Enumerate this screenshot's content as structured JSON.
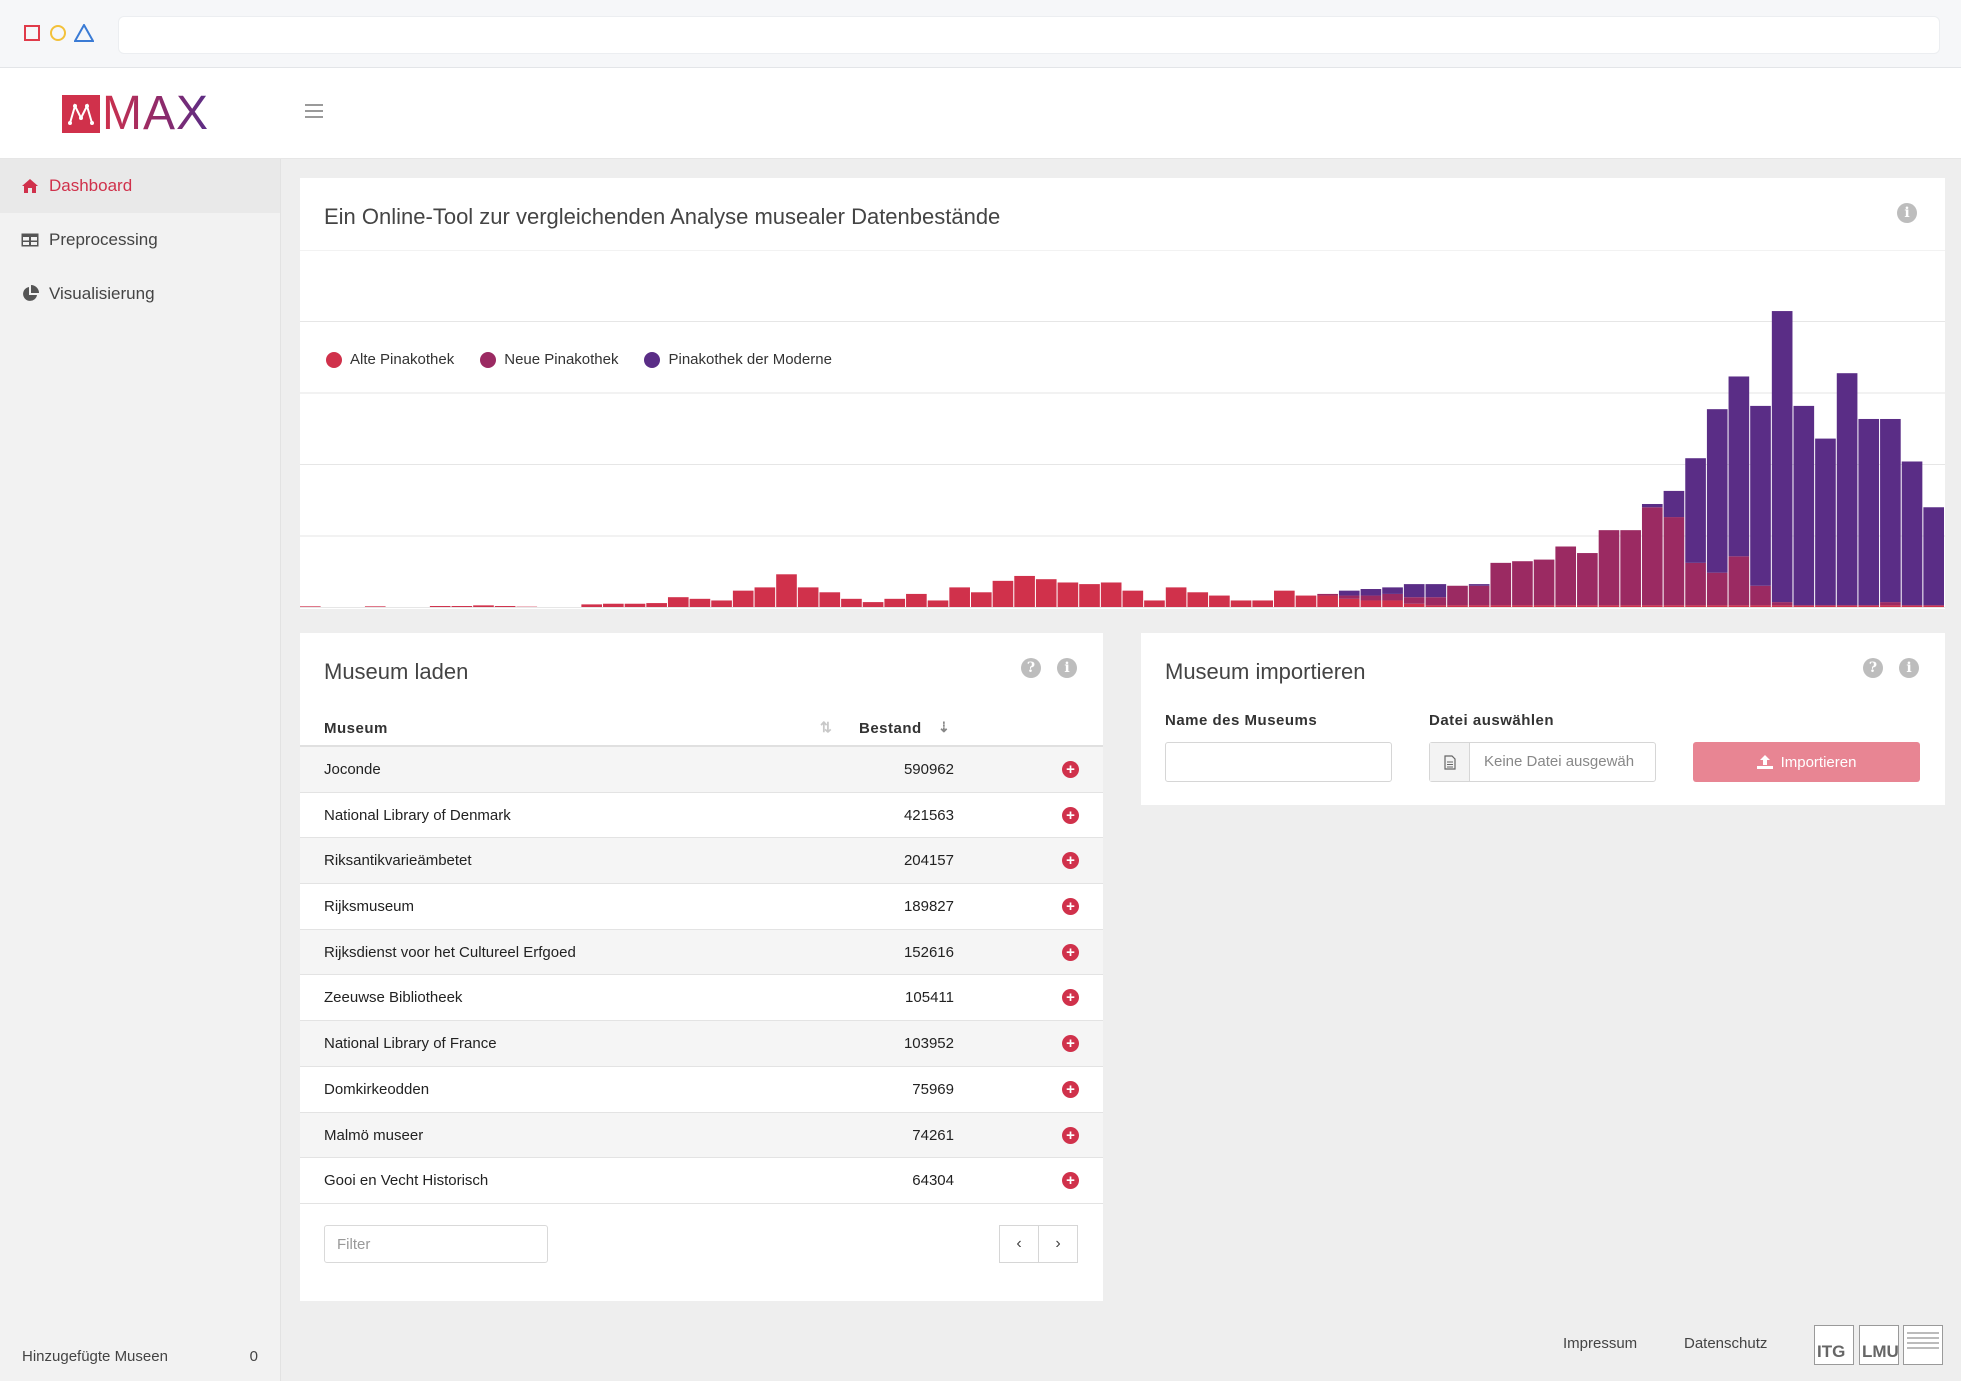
{
  "colors": {
    "accent": "#d0314b",
    "alte": "#d0314b",
    "neue": "#9b2a62",
    "moderne": "#5a2d86"
  },
  "header": {
    "logo_text": "MAX",
    "menu_icon": "hamburger-icon"
  },
  "sidebar": {
    "items": [
      {
        "label": "Dashboard",
        "icon": "home-icon",
        "active": true
      },
      {
        "label": "Preprocessing",
        "icon": "table-icon",
        "active": false
      },
      {
        "label": "Visualisierung",
        "icon": "pie-chart-icon",
        "active": false
      }
    ],
    "footer": {
      "label": "Hinzugefügte Museen",
      "count": "0"
    }
  },
  "chart_card": {
    "title": "Ein Online-Tool zur vergleichenden Analyse musealer Datenbestände"
  },
  "chart_data": {
    "type": "bar",
    "stacked": true,
    "legend_position": "top-left",
    "grid": true,
    "series": [
      {
        "name": "Alte Pinakothek",
        "color": "#d0314b"
      },
      {
        "name": "Neue Pinakothek",
        "color": "#9b2a62"
      },
      {
        "name": "Pinakothek der Moderne",
        "color": "#5a2d86"
      }
    ],
    "values": [
      [
        0.2,
        0,
        0
      ],
      [
        0,
        0,
        0
      ],
      [
        0,
        0,
        0
      ],
      [
        0.2,
        0,
        0
      ],
      [
        0,
        0,
        0
      ],
      [
        0,
        0,
        0
      ],
      [
        0.3,
        0,
        0
      ],
      [
        0.3,
        0,
        0
      ],
      [
        0.5,
        0,
        0
      ],
      [
        0.3,
        0,
        0
      ],
      [
        0.1,
        0,
        0
      ],
      [
        0,
        0,
        0
      ],
      [
        0,
        0,
        0
      ],
      [
        0.8,
        0,
        0
      ],
      [
        1,
        0,
        0
      ],
      [
        1,
        0,
        0
      ],
      [
        1.2,
        0,
        0
      ],
      [
        3,
        0,
        0
      ],
      [
        2.5,
        0,
        0
      ],
      [
        2,
        0,
        0
      ],
      [
        5,
        0,
        0
      ],
      [
        6,
        0,
        0
      ],
      [
        10,
        0,
        0
      ],
      [
        6,
        0,
        0
      ],
      [
        4.5,
        0,
        0
      ],
      [
        2.5,
        0,
        0
      ],
      [
        1.5,
        0,
        0
      ],
      [
        2.5,
        0,
        0
      ],
      [
        4,
        0,
        0
      ],
      [
        2,
        0,
        0
      ],
      [
        6,
        0,
        0
      ],
      [
        4.5,
        0,
        0
      ],
      [
        8,
        0,
        0
      ],
      [
        9.5,
        0,
        0
      ],
      [
        8.5,
        0,
        0
      ],
      [
        7.5,
        0,
        0
      ],
      [
        7,
        0,
        0
      ],
      [
        7.5,
        0,
        0
      ],
      [
        5,
        0,
        0
      ],
      [
        2,
        0,
        0
      ],
      [
        6,
        0,
        0
      ],
      [
        4.5,
        0,
        0
      ],
      [
        3.5,
        0,
        0
      ],
      [
        2,
        0,
        0
      ],
      [
        2,
        0,
        0
      ],
      [
        5,
        0,
        0
      ],
      [
        3.5,
        0,
        0
      ],
      [
        3.5,
        0.5,
        0
      ],
      [
        2.5,
        1,
        1.5
      ],
      [
        2,
        1.5,
        2
      ],
      [
        2,
        2,
        2
      ],
      [
        1,
        2,
        4
      ],
      [
        0.5,
        2.5,
        4
      ],
      [
        0.5,
        6,
        0
      ],
      [
        0.5,
        6,
        0.5
      ],
      [
        0.5,
        13,
        0
      ],
      [
        0.5,
        13.5,
        0
      ],
      [
        0.5,
        14,
        0
      ],
      [
        0.5,
        18,
        0
      ],
      [
        0.5,
        16,
        0
      ],
      [
        0.5,
        23,
        0
      ],
      [
        0.5,
        23,
        0
      ],
      [
        0.5,
        30,
        1
      ],
      [
        0.5,
        27,
        8
      ],
      [
        0.5,
        13,
        32
      ],
      [
        0.5,
        10,
        50
      ],
      [
        0.5,
        15,
        55
      ],
      [
        0.5,
        6,
        55
      ],
      [
        0.5,
        1,
        89
      ],
      [
        0.5,
        0,
        61
      ],
      [
        0.5,
        0,
        51
      ],
      [
        0.5,
        0,
        71
      ],
      [
        0.5,
        0,
        57
      ],
      [
        0.5,
        1,
        56
      ],
      [
        0.5,
        0,
        44
      ],
      [
        0.5,
        0,
        30
      ]
    ],
    "ylim": [
      0,
      100
    ]
  },
  "laden": {
    "title": "Museum laden",
    "col_museum": "Museum",
    "col_bestand": "Bestand",
    "rows": [
      {
        "name": "Joconde",
        "value": "590962"
      },
      {
        "name": "National Library of Denmark",
        "value": "421563"
      },
      {
        "name": "Riksantikvarieämbetet",
        "value": "204157"
      },
      {
        "name": "Rijksmuseum",
        "value": "189827"
      },
      {
        "name": "Rijksdienst voor het Cultureel Erfgoed",
        "value": "152616"
      },
      {
        "name": "Zeeuwse Bibliotheek",
        "value": "105411"
      },
      {
        "name": "National Library of France",
        "value": "103952"
      },
      {
        "name": "Domkirkeodden",
        "value": "75969"
      },
      {
        "name": "Malmö museer",
        "value": "74261"
      },
      {
        "name": "Gooi en Vecht Historisch",
        "value": "64304"
      }
    ],
    "filter_placeholder": "Filter"
  },
  "import": {
    "title": "Museum importieren",
    "name_label": "Name des Museums",
    "file_label": "Datei auswählen",
    "file_placeholder": "Keine Datei ausgewäh",
    "button_label": "Importieren"
  },
  "footer": {
    "impressum": "Impressum",
    "datenschutz": "Datenschutz",
    "logo1": "ITG",
    "logo2": "LMU"
  }
}
